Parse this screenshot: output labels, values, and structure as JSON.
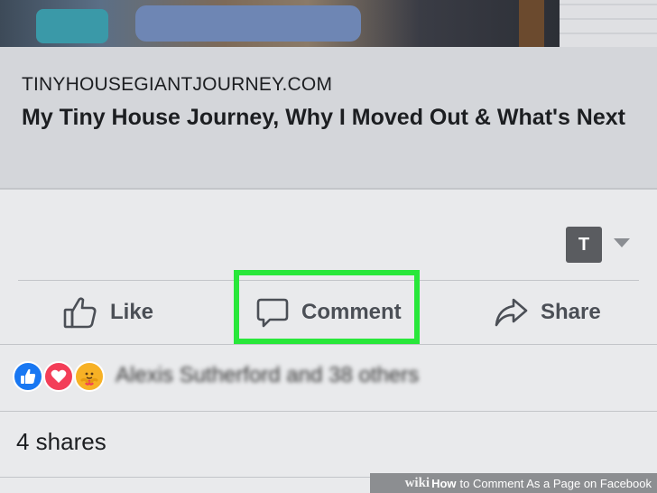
{
  "link_preview": {
    "domain": "TINYHOUSEGIANTJOURNEY.COM",
    "title": "My Tiny House Journey, Why I Moved Out & What's Next"
  },
  "page_avatar": {
    "letter": "T"
  },
  "actions": {
    "like_label": "Like",
    "comment_label": "Comment",
    "share_label": "Share"
  },
  "reactions": {
    "icons": [
      "like-reaction-icon",
      "love-reaction-icon",
      "care-reaction-icon"
    ],
    "names_text": "Alexis Sutherford and 38 others"
  },
  "shares_text": "4 shares",
  "watermark": {
    "brand": "wiki",
    "how": "How",
    "rest": "to Comment As a Page on Facebook"
  },
  "colors": {
    "highlight": "#28e73a",
    "like_blue": "#1877f2",
    "love_red": "#f33e58",
    "care_yellow": "#f7b125"
  }
}
